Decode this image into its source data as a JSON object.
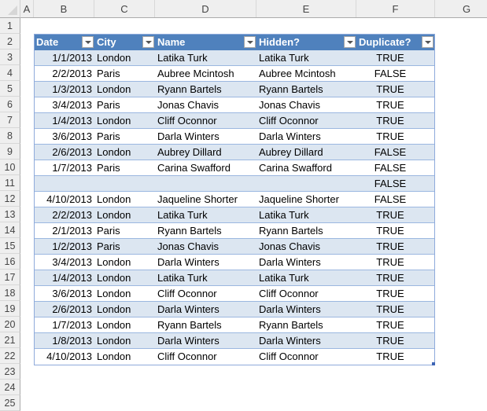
{
  "sheet": {
    "columns": [
      "A",
      "B",
      "C",
      "D",
      "E",
      "F",
      "G"
    ],
    "rows": [
      "1",
      "2",
      "3",
      "4",
      "5",
      "6",
      "7",
      "8",
      "9",
      "10",
      "11",
      "12",
      "13",
      "14",
      "15",
      "16",
      "17",
      "18",
      "19",
      "20",
      "21",
      "22",
      "23",
      "24",
      "25"
    ]
  },
  "table": {
    "headers": {
      "date": "Date",
      "city": "City",
      "name": "Name",
      "hidden": "Hidden?",
      "duplicate": "Duplicate?"
    },
    "rows": [
      {
        "date": "1/1/2013",
        "city": "London",
        "name": "Latika Turk",
        "hidden": "Latika Turk",
        "duplicate": "TRUE"
      },
      {
        "date": "2/2/2013",
        "city": "Paris",
        "name": "Aubree Mcintosh",
        "hidden": "Aubree Mcintosh",
        "duplicate": "FALSE"
      },
      {
        "date": "1/3/2013",
        "city": "London",
        "name": "Ryann Bartels",
        "hidden": "Ryann Bartels",
        "duplicate": "TRUE"
      },
      {
        "date": "3/4/2013",
        "city": "Paris",
        "name": "Jonas Chavis",
        "hidden": "Jonas Chavis",
        "duplicate": "TRUE"
      },
      {
        "date": "1/4/2013",
        "city": "London",
        "name": "Cliff Oconnor",
        "hidden": "Cliff Oconnor",
        "duplicate": "TRUE"
      },
      {
        "date": "3/6/2013",
        "city": "Paris",
        "name": "Darla Winters",
        "hidden": "Darla Winters",
        "duplicate": "TRUE"
      },
      {
        "date": "2/6/2013",
        "city": "London",
        "name": "Aubrey Dillard",
        "hidden": "Aubrey Dillard",
        "duplicate": "FALSE"
      },
      {
        "date": "1/7/2013",
        "city": "Paris",
        "name": "Carina Swafford",
        "hidden": "Carina Swafford",
        "duplicate": "FALSE"
      },
      {
        "date": "",
        "city": "",
        "name": "",
        "hidden": "",
        "duplicate": "FALSE"
      },
      {
        "date": "4/10/2013",
        "city": "London",
        "name": "Jaqueline Shorter",
        "hidden": "Jaqueline Shorter",
        "duplicate": "FALSE"
      },
      {
        "date": "2/2/2013",
        "city": "London",
        "name": "Latika Turk",
        "hidden": "Latika Turk",
        "duplicate": "TRUE"
      },
      {
        "date": "2/1/2013",
        "city": "Paris",
        "name": "Ryann Bartels",
        "hidden": "Ryann Bartels",
        "duplicate": "TRUE"
      },
      {
        "date": "1/2/2013",
        "city": "Paris",
        "name": "Jonas Chavis",
        "hidden": "Jonas Chavis",
        "duplicate": "TRUE"
      },
      {
        "date": "3/4/2013",
        "city": "London",
        "name": "Darla Winters",
        "hidden": "Darla Winters",
        "duplicate": "TRUE"
      },
      {
        "date": "1/4/2013",
        "city": "London",
        "name": "Latika Turk",
        "hidden": "Latika Turk",
        "duplicate": "TRUE"
      },
      {
        "date": "3/6/2013",
        "city": "London",
        "name": "Cliff Oconnor",
        "hidden": "Cliff Oconnor",
        "duplicate": "TRUE"
      },
      {
        "date": "2/6/2013",
        "city": "London",
        "name": "Darla Winters",
        "hidden": "Darla Winters",
        "duplicate": "TRUE"
      },
      {
        "date": "1/7/2013",
        "city": "London",
        "name": "Ryann Bartels",
        "hidden": "Ryann Bartels",
        "duplicate": "TRUE"
      },
      {
        "date": "1/8/2013",
        "city": "London",
        "name": "Darla Winters",
        "hidden": "Darla Winters",
        "duplicate": "TRUE"
      },
      {
        "date": "4/10/2013",
        "city": "London",
        "name": "Cliff Oconnor",
        "hidden": "Cliff Oconnor",
        "duplicate": "TRUE"
      }
    ]
  },
  "colors": {
    "header_bg": "#4f81bd",
    "band_bg": "#dce6f1",
    "border": "#8eaadb"
  }
}
